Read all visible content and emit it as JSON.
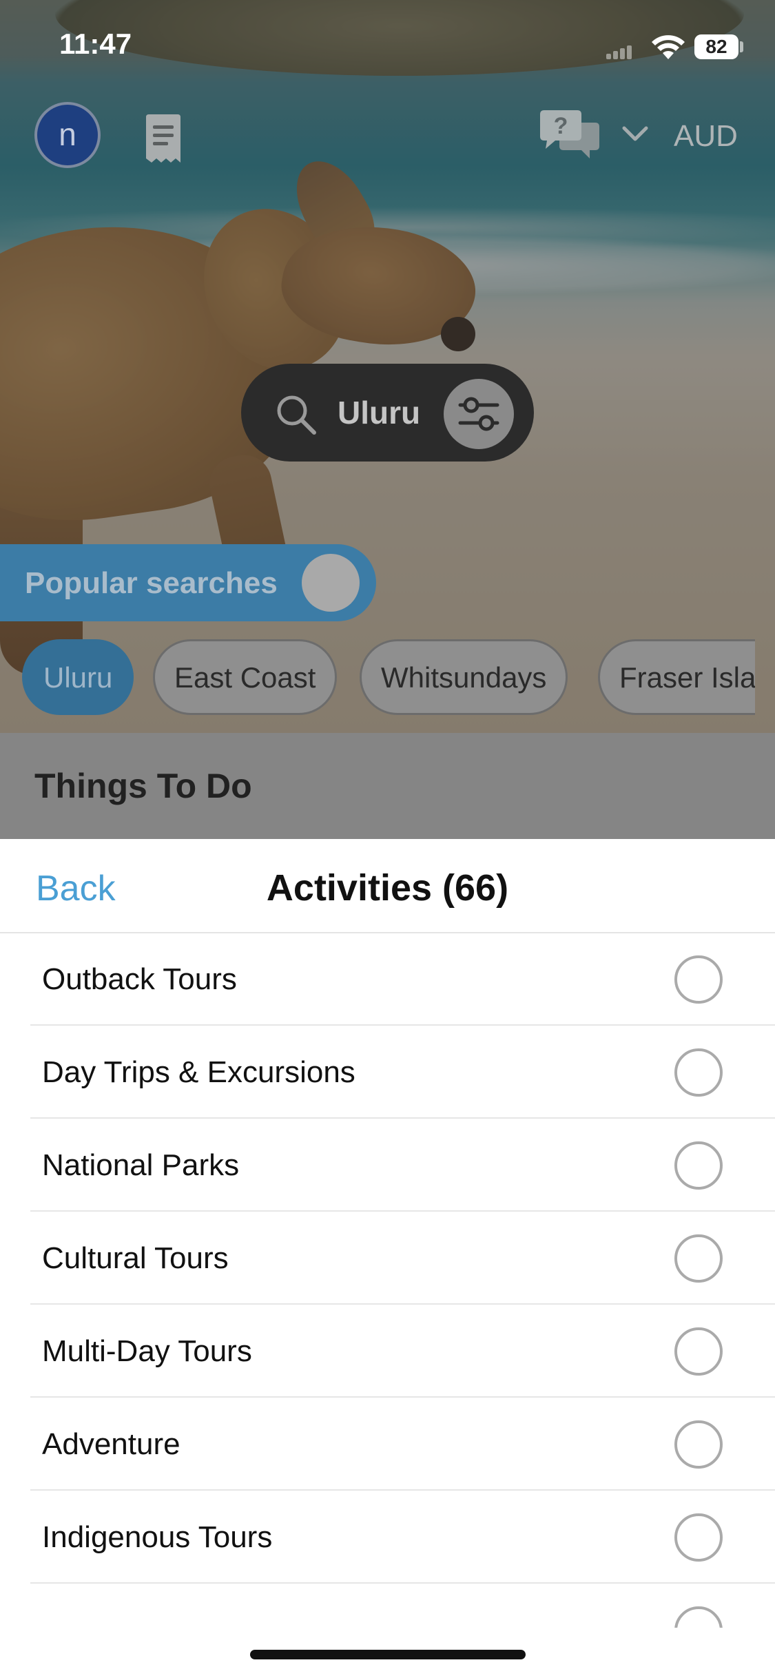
{
  "status_bar": {
    "time": "11:47",
    "battery": "82"
  },
  "header": {
    "avatar_initial": "n",
    "currency": "AUD",
    "icons": [
      "receipt-icon",
      "chat-help-icon",
      "chevron-down-icon"
    ]
  },
  "search": {
    "query": "Uluru",
    "icons": [
      "search-icon",
      "filter-sliders-icon"
    ]
  },
  "popular": {
    "label": "Popular searches",
    "chips": [
      {
        "label": "Uluru",
        "active": true
      },
      {
        "label": "East Coast",
        "active": false
      },
      {
        "label": "Whitsundays",
        "active": false
      },
      {
        "label": "Fraser Island",
        "active": false
      }
    ]
  },
  "section": {
    "title": "Things To Do"
  },
  "sheet": {
    "back_label": "Back",
    "title": "Activities (66)",
    "items": [
      {
        "label": "Outback Tours",
        "selected": false
      },
      {
        "label": "Day Trips & Excursions",
        "selected": false
      },
      {
        "label": "National Parks",
        "selected": false
      },
      {
        "label": "Cultural Tours",
        "selected": false
      },
      {
        "label": "Multi-Day Tours",
        "selected": false
      },
      {
        "label": "Adventure",
        "selected": false
      },
      {
        "label": "Indigenous Tours",
        "selected": false
      }
    ]
  },
  "colors": {
    "accent": "#4a9fd4",
    "chip_active": "#346f96",
    "avatar": "#1e3f80"
  }
}
